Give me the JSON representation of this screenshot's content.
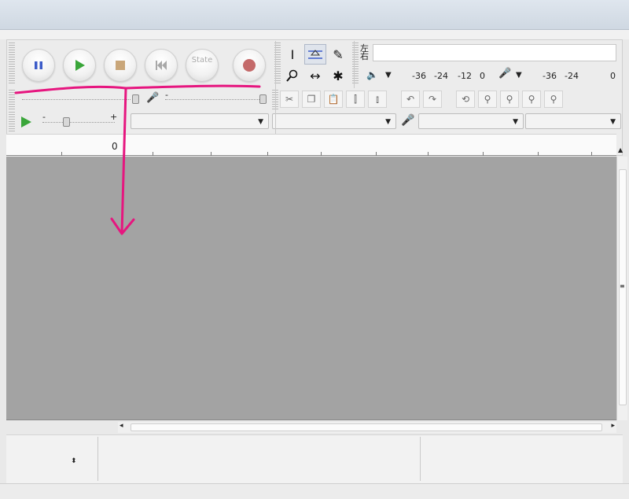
{
  "transport": {
    "pause": "pause-icon",
    "play": "play-icon",
    "stop": "stop-icon",
    "skip_start": "skip-to-start-icon",
    "state_label": "State",
    "record": "record-icon",
    "colors": {
      "pause": "#3b5bc8",
      "play": "#3aa63a",
      "stop": "#c9a679",
      "skip": "#a8a8a8",
      "record": "#c46a6a"
    }
  },
  "tools": [
    "selection-tool",
    "envelope-tool",
    "draw-tool",
    "zoom-tool",
    "timeshift-tool",
    "multi-tool"
  ],
  "meters": {
    "playback_ticks": [
      "-36",
      "-24",
      "-12",
      "0"
    ],
    "record_ticks": [
      "-36",
      "-24",
      "0"
    ]
  },
  "mixer": {
    "minus": "-",
    "plus": "+"
  },
  "device": {
    "play_minus": "-",
    "play_plus": "+"
  },
  "ruler": {
    "label": "0"
  },
  "annotation": {
    "color": "#e6167f"
  }
}
